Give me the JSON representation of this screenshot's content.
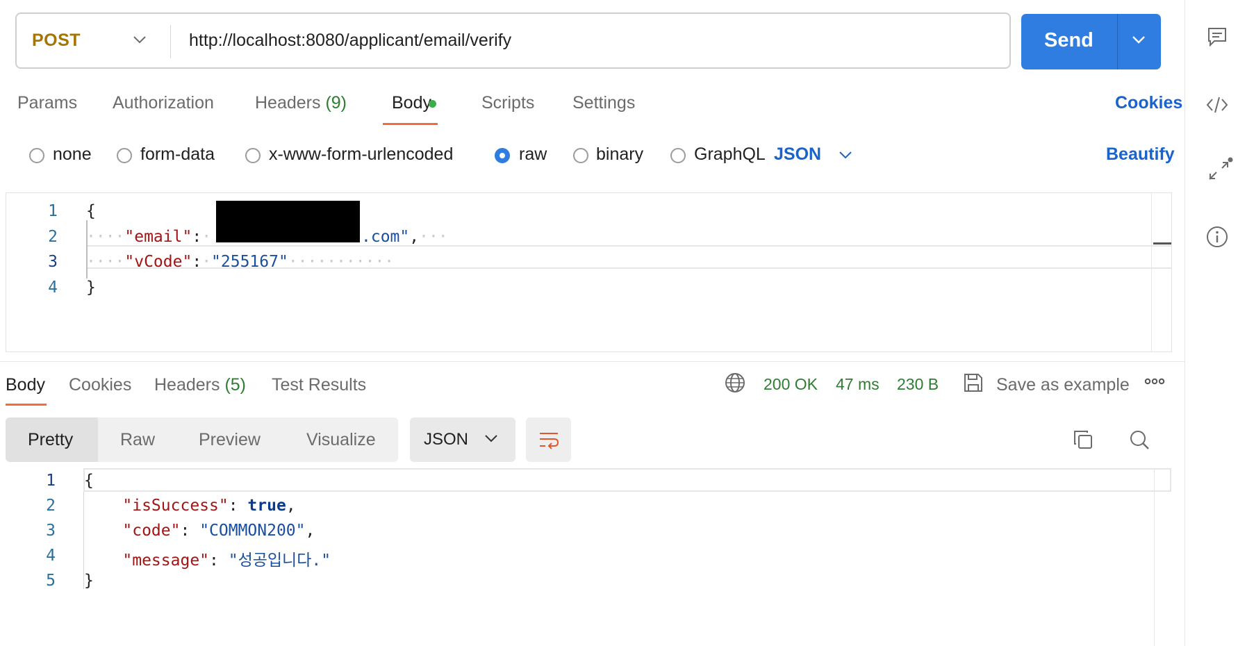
{
  "request": {
    "method": "POST",
    "url": "http://localhost:8080/applicant/email/verify",
    "send_label": "Send"
  },
  "request_tabs": [
    {
      "label": "Params"
    },
    {
      "label": "Authorization"
    },
    {
      "label": "Headers",
      "count": "(9)"
    },
    {
      "label": "Body",
      "active": true
    },
    {
      "label": "Scripts"
    },
    {
      "label": "Settings"
    }
  ],
  "cookies_link": "Cookies",
  "body_types": [
    {
      "label": "none",
      "selected": false
    },
    {
      "label": "form-data",
      "selected": false
    },
    {
      "label": "x-www-form-urlencoded",
      "selected": false
    },
    {
      "label": "raw",
      "selected": true
    },
    {
      "label": "binary",
      "selected": false
    },
    {
      "label": "GraphQL",
      "selected": false
    }
  ],
  "raw_format": "JSON",
  "beautify_label": "Beautify",
  "request_body": {
    "line_numbers": [
      "1",
      "2",
      "3",
      "4"
    ],
    "open_brace": "{",
    "email_key": "\"email\"",
    "email_value_suffix": ".com\"",
    "vcode_key": "\"vCode\"",
    "vcode_value": "\"255167\"",
    "close_brace": "}"
  },
  "response_tabs": [
    {
      "label": "Body",
      "active": true
    },
    {
      "label": "Cookies"
    },
    {
      "label": "Headers",
      "count": "(5)"
    },
    {
      "label": "Test Results"
    }
  ],
  "response_meta": {
    "status": "200 OK",
    "time": "47 ms",
    "size": "230 B",
    "save_as_example": "Save as example"
  },
  "view_modes": [
    "Pretty",
    "Raw",
    "Preview",
    "Visualize"
  ],
  "response_format": "JSON",
  "response_body": {
    "line_numbers": [
      "1",
      "2",
      "3",
      "4",
      "5"
    ],
    "open_brace": "{",
    "is_success_key": "\"isSuccess\"",
    "is_success_value": "true",
    "code_key": "\"code\"",
    "code_value": "\"COMMON200\"",
    "message_key": "\"message\"",
    "message_value": "\"성공입니다.\"",
    "close_brace": "}"
  },
  "colors": {
    "accent": "#2f7de1",
    "method": "#a47500",
    "status_ok": "#2e7d32",
    "active_tab_underline": "#f26b3a",
    "json_key": "#a31515",
    "json_string": "#1a4fa0"
  },
  "icons": [
    "chevron-down-icon",
    "comment-icon",
    "code-icon",
    "collapse-icon",
    "info-icon",
    "globe-icon",
    "save-icon",
    "more-icon",
    "wrap-lines-icon",
    "copy-icon",
    "search-icon"
  ]
}
